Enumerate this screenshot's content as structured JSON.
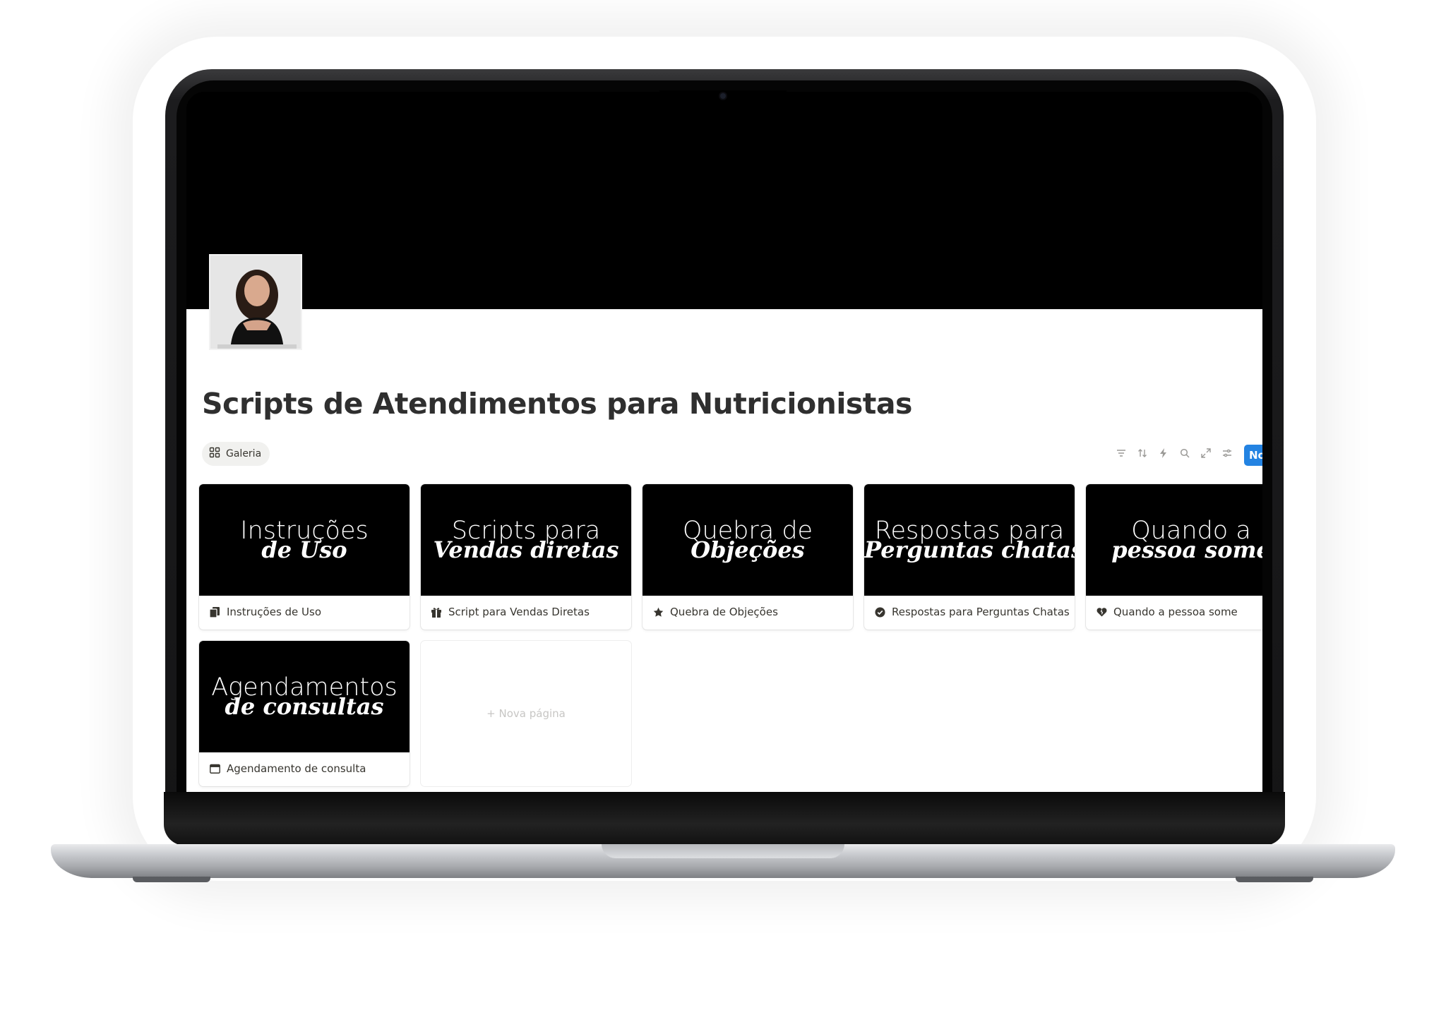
{
  "page": {
    "title": "Scripts de Atendimentos para Nutricionistas"
  },
  "view": {
    "tab_label": "Galeria",
    "new_button_label": "No"
  },
  "toolbar": {
    "icons": [
      "filter-icon",
      "sort-icon",
      "lightning-icon",
      "search-icon",
      "expand-icon",
      "settings-icon"
    ]
  },
  "cards": [
    {
      "cover_line1": "Instruções",
      "cover_line2": "de Uso",
      "title": "Instruções de Uso",
      "icon": "document-icon"
    },
    {
      "cover_line1": "Scripts para",
      "cover_line2": "Vendas diretas",
      "title": "Script para Vendas Diretas",
      "icon": "gift-icon"
    },
    {
      "cover_line1": "Quebra de",
      "cover_line2": "Objeções",
      "title": "Quebra de Objeções",
      "icon": "star-icon"
    },
    {
      "cover_line1": "Respostas para",
      "cover_line2": "Perguntas chatas",
      "title": "Respostas para Perguntas Chatas",
      "icon": "check-circle-icon"
    },
    {
      "cover_line1": "Quando a",
      "cover_line2": "pessoa some",
      "title": "Quando a pessoa some",
      "icon": "heart-icon"
    },
    {
      "cover_line1": "Agendamentos",
      "cover_line2": "de consultas",
      "title": "Agendamento de consulta",
      "icon": "calendar-icon"
    }
  ],
  "new_page": {
    "label": "+ Nova página"
  },
  "colors": {
    "accent": "#2383e2",
    "text": "#37352f",
    "cover_bg": "#000000"
  }
}
